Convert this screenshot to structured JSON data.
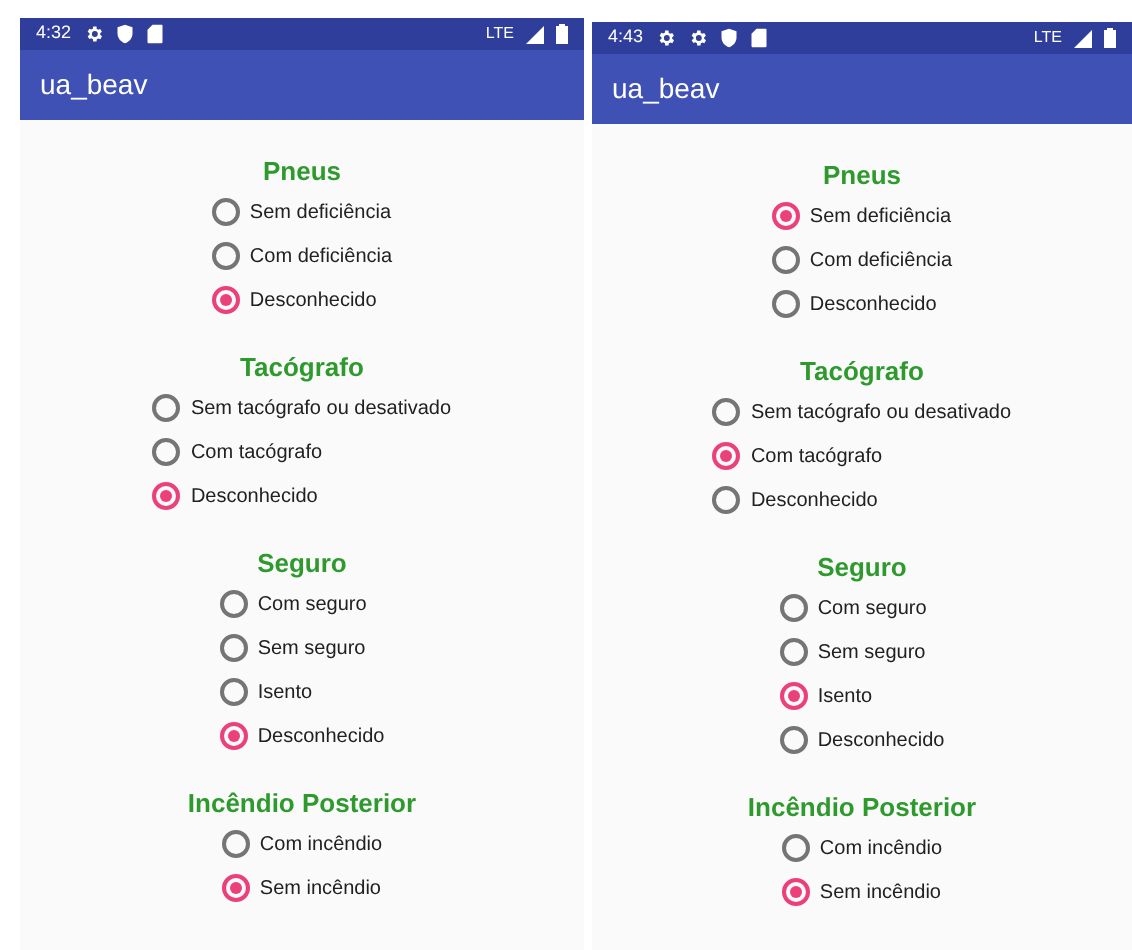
{
  "screens": [
    {
      "status_bar": {
        "time": "4:32",
        "notification_icons": [
          {
            "kind": "gear"
          },
          {
            "kind": "shield"
          },
          {
            "kind": "sd"
          }
        ],
        "network": "LTE"
      },
      "app_bar": {
        "title": "ua_beav"
      },
      "sections": [
        {
          "title": "Pneus",
          "options": [
            {
              "label": "Sem deficiência",
              "selected": false
            },
            {
              "label": "Com deficiência",
              "selected": false
            },
            {
              "label": "Desconhecido",
              "selected": true
            }
          ]
        },
        {
          "title": "Tacógrafo",
          "options": [
            {
              "label": "Sem tacógrafo ou desativado",
              "selected": false
            },
            {
              "label": "Com tacógrafo",
              "selected": false
            },
            {
              "label": "Desconhecido",
              "selected": true
            }
          ]
        },
        {
          "title": "Seguro",
          "options": [
            {
              "label": "Com seguro",
              "selected": false
            },
            {
              "label": "Sem seguro",
              "selected": false
            },
            {
              "label": "Isento",
              "selected": false
            },
            {
              "label": "Desconhecido",
              "selected": true
            }
          ]
        },
        {
          "title": "Incêndio Posterior",
          "options": [
            {
              "label": "Com incêndio",
              "selected": false
            },
            {
              "label": "Sem incêndio",
              "selected": true
            }
          ]
        }
      ]
    },
    {
      "status_bar": {
        "time": "4:43",
        "notification_icons": [
          {
            "kind": "gear"
          },
          {
            "kind": "gear"
          },
          {
            "kind": "shield"
          },
          {
            "kind": "sd"
          }
        ],
        "network": "LTE"
      },
      "app_bar": {
        "title": "ua_beav"
      },
      "sections": [
        {
          "title": "Pneus",
          "options": [
            {
              "label": "Sem deficiência",
              "selected": true
            },
            {
              "label": "Com deficiência",
              "selected": false
            },
            {
              "label": "Desconhecido",
              "selected": false
            }
          ]
        },
        {
          "title": "Tacógrafo",
          "options": [
            {
              "label": "Sem tacógrafo ou desativado",
              "selected": false
            },
            {
              "label": "Com tacógrafo",
              "selected": true
            },
            {
              "label": "Desconhecido",
              "selected": false
            }
          ]
        },
        {
          "title": "Seguro",
          "options": [
            {
              "label": "Com seguro",
              "selected": false
            },
            {
              "label": "Sem seguro",
              "selected": false
            },
            {
              "label": "Isento",
              "selected": true
            },
            {
              "label": "Desconhecido",
              "selected": false
            }
          ]
        },
        {
          "title": "Incêndio Posterior",
          "options": [
            {
              "label": "Com incêndio",
              "selected": false
            },
            {
              "label": "Sem incêndio",
              "selected": true
            }
          ]
        }
      ]
    }
  ]
}
